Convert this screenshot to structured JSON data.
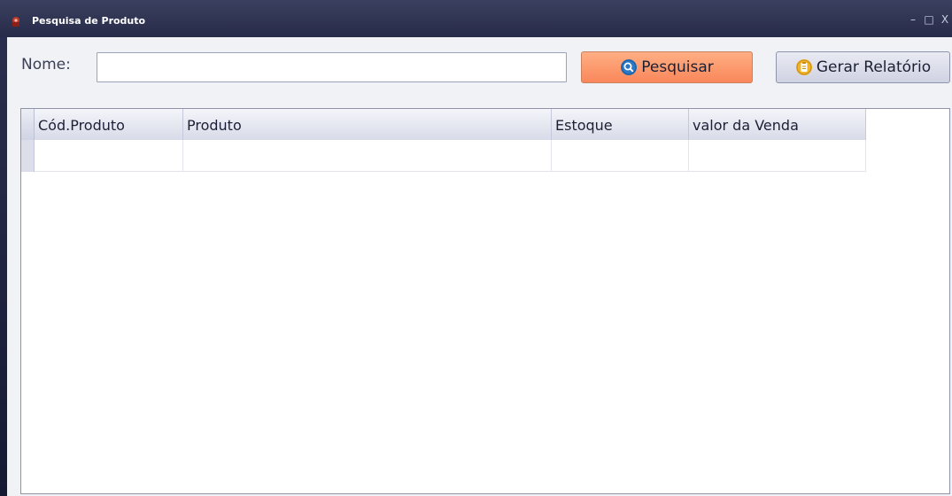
{
  "window": {
    "title": "Pesquisa de Produto",
    "controls": {
      "minimize": "–",
      "maximize": "□",
      "close": "X"
    }
  },
  "search": {
    "name_label": "Nome:",
    "name_value": "",
    "search_button_label": "Pesquisar",
    "report_button_label": "Gerar Relatório"
  },
  "table": {
    "columns": [
      "Cód.Produto",
      "Produto",
      "Estoque",
      "valor da Venda"
    ],
    "rows": [
      [
        "",
        "",
        "",
        ""
      ]
    ]
  },
  "colors": {
    "search_button": "#f9875a",
    "title_bar": "#2b3050",
    "search_icon": "#2b78c4",
    "report_icon": "#f0b429"
  },
  "icons": {
    "app": "app-icon",
    "search": "search-icon",
    "report": "report-icon"
  }
}
